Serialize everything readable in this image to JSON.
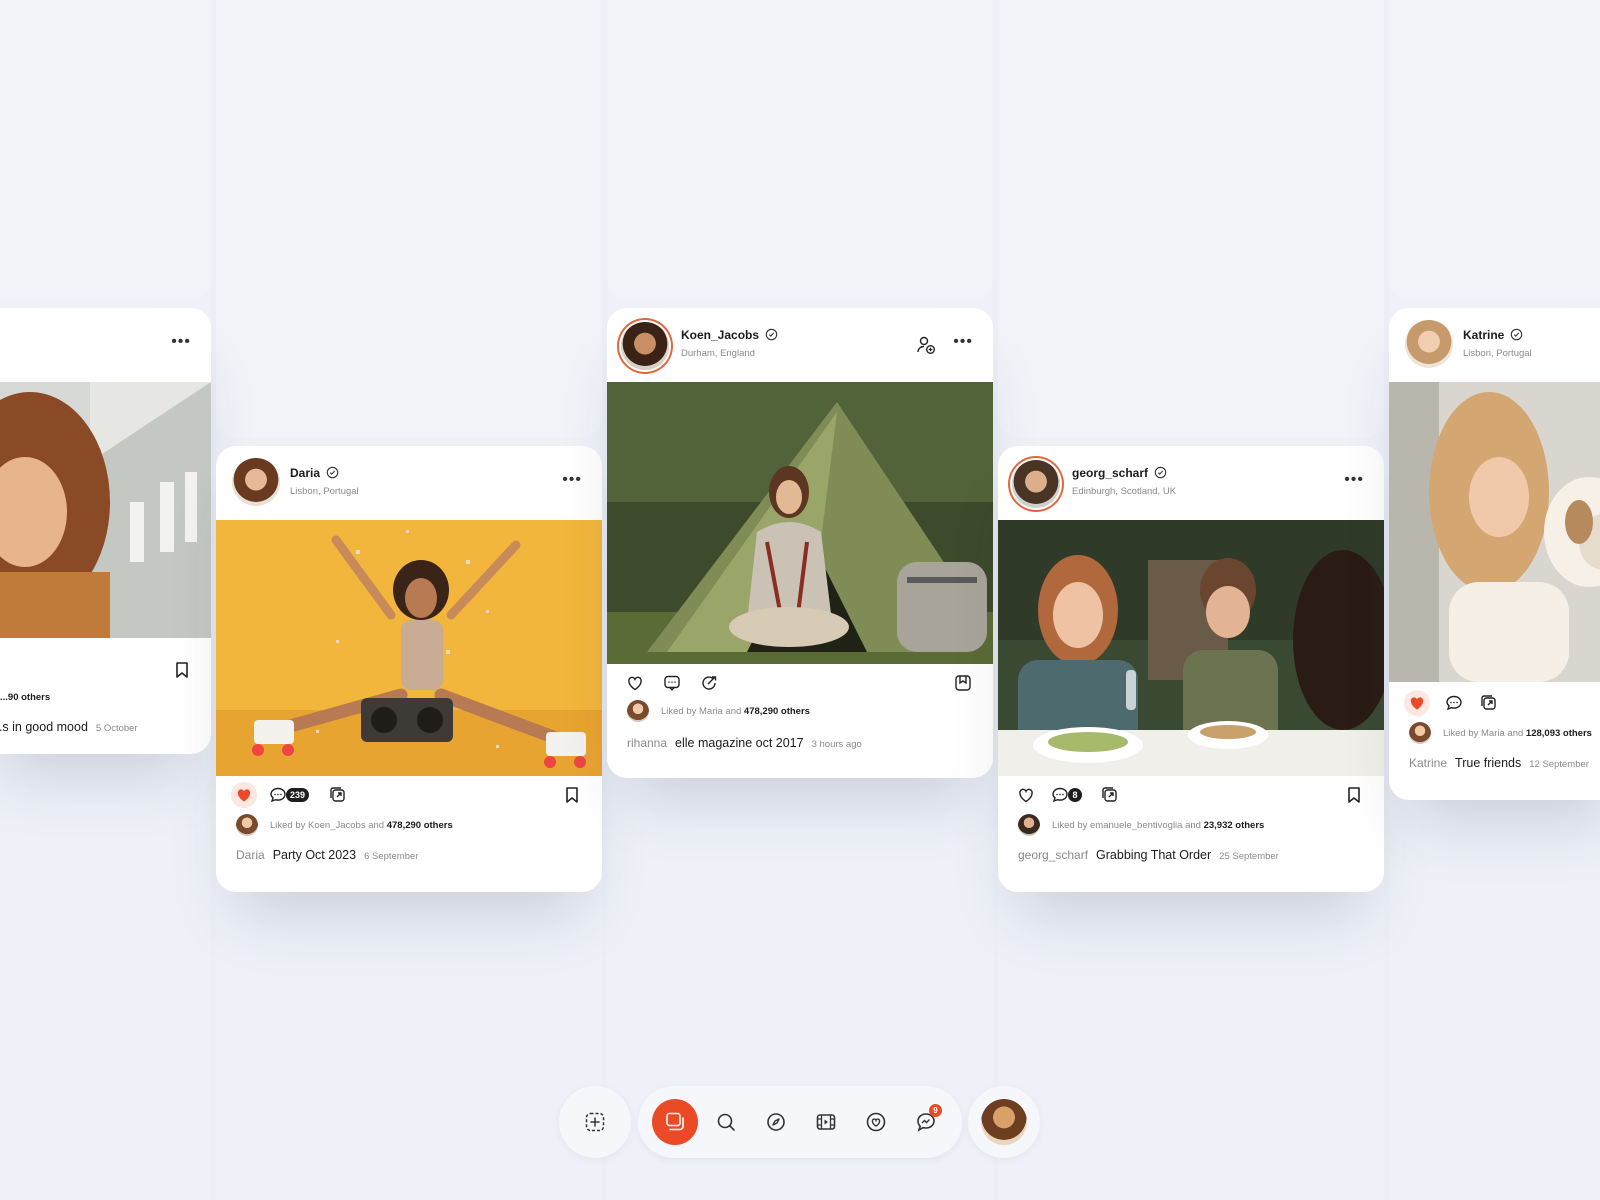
{
  "colors": {
    "accent": "#ea4a26",
    "background": "#eceff6",
    "card": "#ffffff",
    "text_primary": "#1c1c1c",
    "text_secondary": "#8a8a8a"
  },
  "posts": [
    {
      "id": "far-left",
      "caption_text": "...s in good mood",
      "date": "5 October",
      "likes_count": "...90 others",
      "icons": [
        "more-icon",
        "bookmark-icon"
      ]
    },
    {
      "id": "daria",
      "username": "Daria",
      "location": "Lisbon, Portugal",
      "liked_by_prefix": "Liked by Koen_Jacobs and",
      "likes_count": "478,290 others",
      "comment_count": "239",
      "caption_user": "Daria",
      "caption_text": "Party Oct 2023",
      "date": "6 September",
      "liked": true,
      "icons": [
        "heart-icon",
        "comment-icon",
        "share-icon",
        "bookmark-icon",
        "more-icon",
        "verified-icon"
      ]
    },
    {
      "id": "koen",
      "username": "Koen_Jacobs",
      "location": "Durham, England",
      "liked_by_prefix": "Liked by Maria and",
      "likes_count": "478,290 others",
      "caption_user": "rihanna",
      "caption_text": "elle magazine oct 2017",
      "date": "3 hours ago",
      "liked": false,
      "icons": [
        "heart-icon",
        "comment-icon",
        "repost-icon",
        "save-icon",
        "follow-icon",
        "more-icon",
        "verified-icon"
      ]
    },
    {
      "id": "georg",
      "username": "georg_scharf",
      "location": "Edinburgh, Scotland, UK",
      "liked_by_prefix": "Liked by emanuele_bentivoglia and",
      "likes_count": "23,932 others",
      "comment_count": "8",
      "caption_user": "georg_scharf",
      "caption_text": "Grabbing That Order",
      "date": "25 September",
      "liked": false,
      "icons": [
        "heart-icon",
        "comment-icon",
        "share-icon",
        "bookmark-icon",
        "more-icon",
        "verified-icon"
      ]
    },
    {
      "id": "katrine",
      "username": "Katrine",
      "location": "Lisbon, Portugal",
      "liked_by_prefix": "Liked by Maria and",
      "likes_count": "128,093 others",
      "caption_user": "Katrine",
      "caption_text": "True friends",
      "date": "12 September",
      "liked": true,
      "icons": [
        "heart-icon",
        "comment-icon",
        "share-icon",
        "verified-icon"
      ]
    }
  ],
  "bottom_nav": {
    "items": [
      "add-icon",
      "feed-icon",
      "search-icon",
      "explore-icon",
      "reels-icon",
      "likes-icon",
      "messages-icon",
      "profile-avatar"
    ],
    "active": "feed-icon",
    "messages_badge": "9"
  }
}
